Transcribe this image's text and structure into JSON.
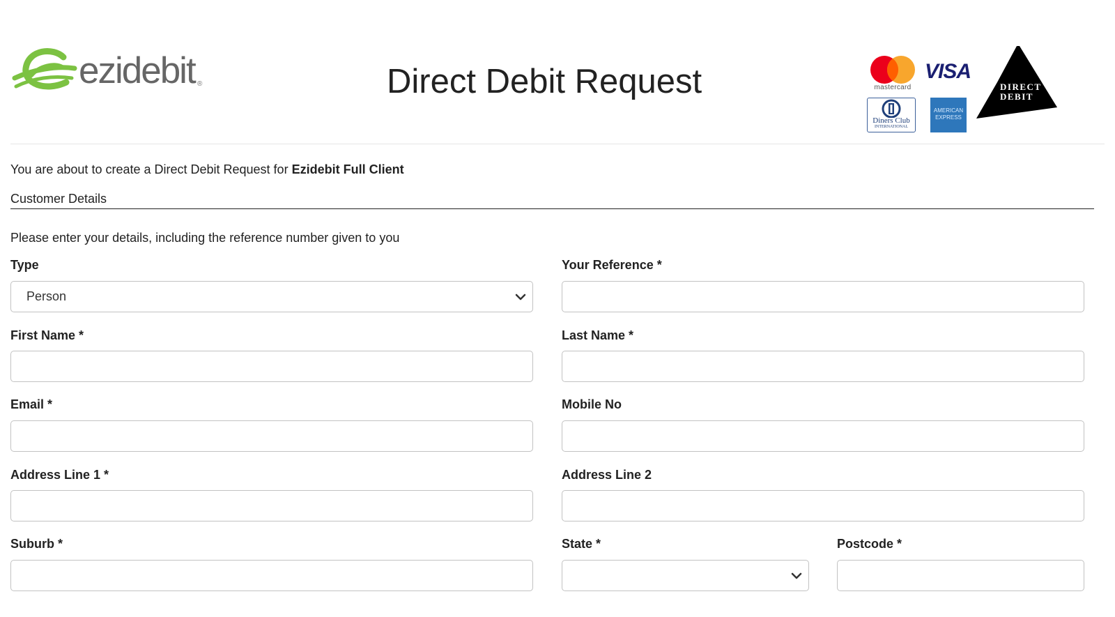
{
  "header": {
    "logo_text": "ezidebit",
    "logo_reg": "®",
    "title": "Direct Debit Request",
    "cards": {
      "mastercard_label": "mastercard",
      "visa_label": "VISA",
      "diners_label": "Diners Club",
      "diners_sub": "INTERNATIONAL",
      "amex_line1": "AMERICAN",
      "amex_line2": "EXPRESS",
      "direct_debit_line1": "DIRECT",
      "direct_debit_line2": "DEBIT"
    },
    "colors": {
      "logo_green": "#7cc242",
      "mastercard_red": "#eb001b",
      "mastercard_orange": "#f79e1b",
      "visa_blue": "#1a1f71",
      "amex_blue": "#2e77bb"
    }
  },
  "intro": {
    "prefix": "You are about to create a Direct Debit Request for",
    "client": "Ezidebit Full Client"
  },
  "section": {
    "title": "Customer Details",
    "instructions": "Please enter your details, including the reference number given to you"
  },
  "form": {
    "type": {
      "label": "Type",
      "value": "Person"
    },
    "your_reference": {
      "label": "Your Reference  *",
      "value": ""
    },
    "first_name": {
      "label": "First Name  *",
      "value": ""
    },
    "last_name": {
      "label": "Last Name  *",
      "value": ""
    },
    "email": {
      "label": "Email  *",
      "value": ""
    },
    "mobile_no": {
      "label": "Mobile No",
      "value": ""
    },
    "address_line_1": {
      "label": "Address Line 1  *",
      "value": ""
    },
    "address_line_2": {
      "label": "Address Line 2",
      "value": ""
    },
    "suburb": {
      "label": "Suburb  *",
      "value": ""
    },
    "state": {
      "label": "State  *",
      "value": ""
    },
    "postcode": {
      "label": "Postcode  *",
      "value": ""
    }
  },
  "icons": [
    "ezidebit-logo-icon",
    "mastercard-icon",
    "visa-icon",
    "diners-club-icon",
    "american-express-icon",
    "direct-debit-icon",
    "chevron-down-icon"
  ]
}
